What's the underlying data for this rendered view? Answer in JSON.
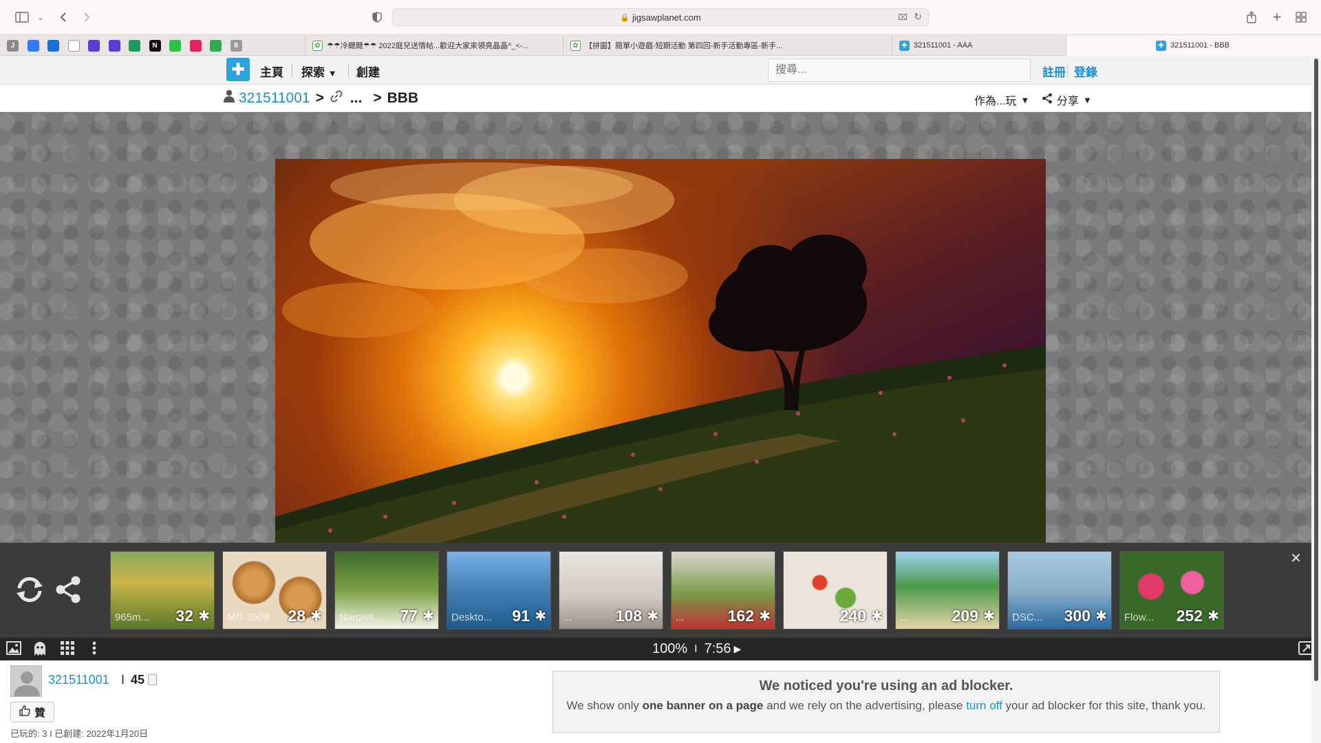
{
  "browser": {
    "url": "jigsawplanet.com",
    "bookmarks": [
      {
        "letter": "J",
        "color": "#8a8a8a"
      },
      {
        "letter": "",
        "color": "#3478f6"
      },
      {
        "letter": "",
        "color": "#1971d6"
      },
      {
        "letter": "",
        "color": "#ffffff"
      },
      {
        "letter": "",
        "color": "#5b3fd4"
      },
      {
        "letter": "",
        "color": "#5b3fd4"
      },
      {
        "letter": "",
        "color": "#1e9b5a"
      },
      {
        "letter": "N",
        "color": "#111111"
      },
      {
        "letter": "",
        "color": "#2fbf4a"
      },
      {
        "letter": "",
        "color": "#e0245e"
      },
      {
        "letter": "",
        "color": "#34a853"
      },
      {
        "letter": "8",
        "color": "#9a9a9a"
      }
    ],
    "tabs": [
      {
        "title": "☂☂冷颼颼☂☂ 2022庭兒送情帖...歡迎大家來領亮晶晶^_<-...",
        "active": false
      },
      {
        "title": "【拼圖】簡單小遊戲-短期活動 第四回-新手活動專區-新手...",
        "active": false
      },
      {
        "title": "321511001 - AAA",
        "active": false
      },
      {
        "title": "321511001 - BBB",
        "active": true
      }
    ]
  },
  "nav": {
    "home": "主頁",
    "explore": "探索",
    "create": "創建",
    "search_placeholder": "搜尋...",
    "register": "註冊",
    "login": "登錄"
  },
  "breadcrumb": {
    "user": "321511001",
    "sep": ">",
    "ellipsis": "...",
    "title": "BBB",
    "play_as": "作為...玩",
    "share": "分享"
  },
  "thumbnails": [
    {
      "name": "965m...",
      "count": "32"
    },
    {
      "name": "MG 3508",
      "count": "28"
    },
    {
      "name": "Narciss...",
      "count": "77"
    },
    {
      "name": "Deskto...",
      "count": "91"
    },
    {
      "name": "...",
      "count": "108"
    },
    {
      "name": "...",
      "count": "162"
    },
    {
      "name": "",
      "count": "240"
    },
    {
      "name": "...",
      "count": "209"
    },
    {
      "name": "DSC...",
      "count": "300"
    },
    {
      "name": "Flow...",
      "count": "252"
    }
  ],
  "status": {
    "zoom": "100%",
    "sep": "I",
    "time": "7:56"
  },
  "author": {
    "name": "321511001",
    "sep": "I",
    "count": "45"
  },
  "like_label": "贊",
  "meta": "已玩的: 3 I 已創建: 2022年1月20日",
  "ad": {
    "title": "We noticed you're using an ad blocker.",
    "msg_1": "We show only ",
    "msg_bold": "one banner on a page",
    "msg_2": " and we rely on the advertising, please ",
    "msg_link": "turn off",
    "msg_3": " your ad blocker for this site, thank you."
  },
  "colors": {
    "accent": "#1a8fd1",
    "logo": "#2ba3de",
    "puzzle_bg": "#7a7a7a",
    "strip_bg": "#3b3b3b",
    "toolbar_bg": "#262626"
  }
}
